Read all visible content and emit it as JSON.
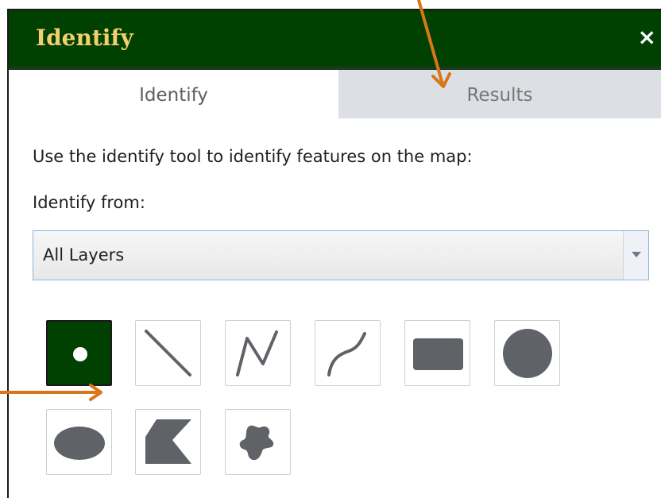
{
  "window": {
    "title": "Identify",
    "close_label": "×"
  },
  "tabs": [
    {
      "label": "Identify",
      "active": true
    },
    {
      "label": "Results",
      "active": false
    }
  ],
  "content": {
    "instructions": "Use the identify tool to identify features on the map:",
    "identify_from_label": "Identify from:",
    "layer_select_value": "All Layers"
  },
  "tools": [
    {
      "name": "point-tool",
      "icon": "point-icon",
      "active": true
    },
    {
      "name": "line-tool",
      "icon": "line-icon",
      "active": false
    },
    {
      "name": "polyline-tool",
      "icon": "polyline-icon",
      "active": false
    },
    {
      "name": "freehand-polyline-tool",
      "icon": "freehand-line-icon",
      "active": false
    },
    {
      "name": "extent-tool",
      "icon": "rectangle-icon",
      "active": false
    },
    {
      "name": "circle-tool",
      "icon": "circle-icon",
      "active": false
    },
    {
      "name": "ellipse-tool",
      "icon": "ellipse-icon",
      "active": false
    },
    {
      "name": "polygon-tool",
      "icon": "polygon-icon",
      "active": false
    },
    {
      "name": "freehand-polygon-tool",
      "icon": "freehand-polygon-icon",
      "active": false
    }
  ],
  "colors": {
    "titlebar": "#004000",
    "title_text": "#f3cf6d",
    "tab_inactive": "#dcdfe3",
    "tool_icon": "#5f6368",
    "annotation_arrow": "#d9761a"
  }
}
